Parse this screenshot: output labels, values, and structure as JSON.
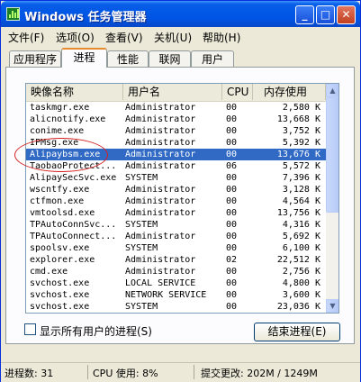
{
  "window": {
    "title": "Windows 任务管理器",
    "minimize": "_",
    "maximize": "□",
    "close": "✕"
  },
  "menu": [
    "文件(F)",
    "选项(O)",
    "查看(V)",
    "关机(U)",
    "帮助(H)"
  ],
  "tabs": [
    "应用程序",
    "进程",
    "性能",
    "联网",
    "用户"
  ],
  "active_tab": 1,
  "columns": [
    "映像名称",
    "用户名",
    "CPU",
    "内存使用"
  ],
  "processes": [
    [
      "taskmgr.exe",
      "Administrator",
      "00",
      "2,580 K"
    ],
    [
      "alicnotify.exe",
      "Administrator",
      "00",
      "13,668 K"
    ],
    [
      "conime.exe",
      "Administrator",
      "00",
      "3,752 K"
    ],
    [
      "IPMsg.exe",
      "Administrator",
      "00",
      "5,392 K"
    ],
    [
      "Alipaybsm.exe",
      "Administrator",
      "00",
      "13,676 K"
    ],
    [
      "TaobaoProtect...",
      "Administrator",
      "06",
      "5,572 K"
    ],
    [
      "AlipaySecSvc.exe",
      "SYSTEM",
      "00",
      "7,396 K"
    ],
    [
      "wscntfy.exe",
      "Administrator",
      "00",
      "3,128 K"
    ],
    [
      "ctfmon.exe",
      "Administrator",
      "00",
      "4,564 K"
    ],
    [
      "vmtoolsd.exe",
      "Administrator",
      "00",
      "13,756 K"
    ],
    [
      "TPAutoConnSvc...",
      "SYSTEM",
      "00",
      "4,316 K"
    ],
    [
      "TPAutoConnect...",
      "Administrator",
      "00",
      "5,692 K"
    ],
    [
      "spoolsv.exe",
      "SYSTEM",
      "00",
      "6,100 K"
    ],
    [
      "explorer.exe",
      "Administrator",
      "02",
      "22,512 K"
    ],
    [
      "cmd.exe",
      "Administrator",
      "00",
      "2,756 K"
    ],
    [
      "svchost.exe",
      "LOCAL SERVICE",
      "00",
      "4,800 K"
    ],
    [
      "svchost.exe",
      "NETWORK SERVICE",
      "00",
      "3,600 K"
    ],
    [
      "svchost.exe",
      "SYSTEM",
      "00",
      "23,036 K"
    ]
  ],
  "selected_row": 4,
  "show_all_label": "显示所有用户的进程(S)",
  "end_process_label": "结束进程(E)",
  "status": {
    "processes": "进程数: 31",
    "cpu": "CPU 使用: 8%",
    "commit": "提交更改: 202M / 1249M"
  },
  "colors": {
    "title_bar": "#0054e3",
    "selection": "#316ac5",
    "annotation_circle": "#d62020",
    "tab_accent": "#e68b2c"
  }
}
